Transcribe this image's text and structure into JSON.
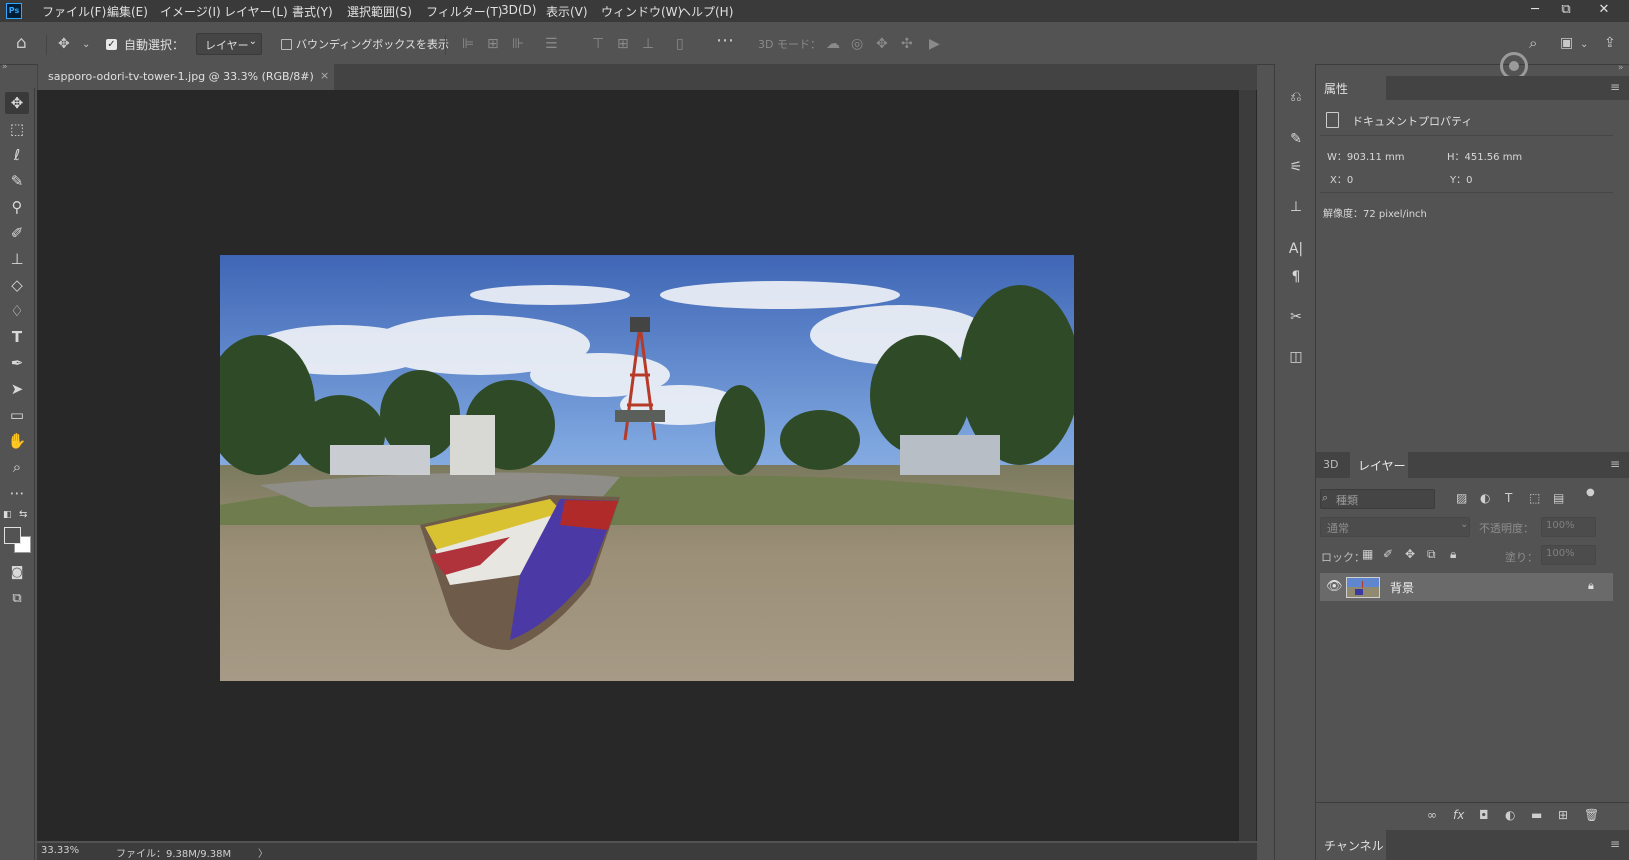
{
  "app": {
    "logo_text": "Ps"
  },
  "menu": [
    "ファイル(F)",
    "編集(E)",
    "イメージ(I)",
    "レイヤー(L)",
    "書式(Y)",
    "選択範囲(S)",
    "フィルター(T)",
    "3D(D)",
    "表示(V)",
    "ウィンドウ(W)",
    "ヘルプ(H)"
  ],
  "window_controls": {
    "minimize": "─",
    "restore": "⧉",
    "close": "✕"
  },
  "options_bar": {
    "auto_select_label": "自動選択：",
    "auto_select_checked": true,
    "auto_select_target": "レイヤー",
    "bounding_box_label": "バウンディングボックスを表示",
    "bounding_box_checked": false,
    "mode_3d_label": "3D モード："
  },
  "document": {
    "tab_title": "sapporo-odori-tv-tower-1.jpg @ 33.3% (RGB/8#)",
    "close_glyph": "×"
  },
  "status_bar": {
    "zoom": "33.33%",
    "file_info": "ファイル：9.38M/9.38M",
    "arrow": "〉"
  },
  "properties_panel": {
    "tab_label": "属性",
    "section_label": "ドキュメントプロパティ",
    "width": "W：903.11 mm",
    "height": "H：451.56 mm",
    "x": "X：0",
    "y": "Y：0",
    "resolution": "解像度：72 pixel/inch"
  },
  "layers_panel": {
    "tab_3d": "3D",
    "tab_layers": "レイヤー",
    "kind_placeholder": "種類",
    "blend_mode": "通常",
    "opacity_label": "不透明度：",
    "opacity_value": "100%",
    "lock_label": "ロック：",
    "fill_label": "塗り：",
    "fill_value": "100%",
    "layers": [
      {
        "name": "背景",
        "visible": true,
        "locked": true
      }
    ]
  },
  "channels_panel": {
    "tab_label": "チャンネル"
  },
  "panel_menu_glyph": "≡",
  "colors": {
    "app_bg": "#535353",
    "canvas_bg": "#282828",
    "menubar_bg": "#3a3a3a",
    "accent_ps": "#31a8ff"
  },
  "icons": {
    "tools": [
      "move-icon",
      "marquee-icon",
      "lasso-icon",
      "quick-select-icon",
      "eyedropper-icon",
      "brush-icon",
      "stamp-icon",
      "eraser-icon",
      "paint-bucket-icon",
      "type-icon",
      "pen-icon",
      "path-select-icon",
      "rectangle-icon",
      "hand-icon",
      "zoom-icon",
      "more-icon"
    ],
    "strip": [
      "history-icon",
      "brush-settings-icon",
      "adjustments-icon",
      "clone-source-icon",
      "character-icon",
      "paragraph-icon",
      "tool-presets-icon",
      "artboard-icon"
    ]
  }
}
